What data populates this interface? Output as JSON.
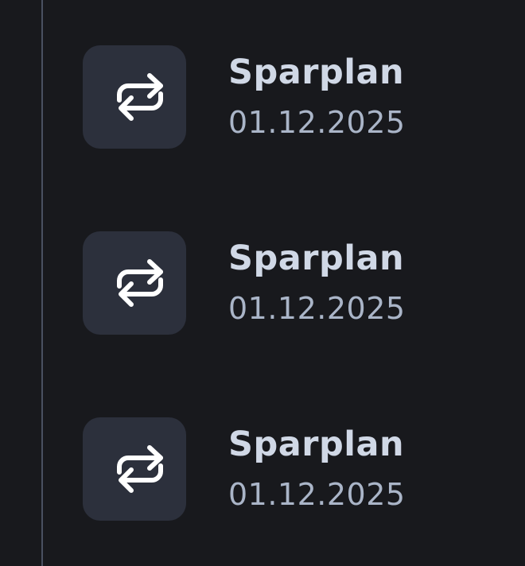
{
  "colors": {
    "background": "#18191d",
    "timeline": "#4a5161",
    "icon_tile": "#2c303c",
    "icon_stroke": "#ffffff",
    "title": "#d0d8e6",
    "date": "#aab5c8"
  },
  "transactions": [
    {
      "icon": "repeat-icon",
      "title": "Sparplan",
      "date": "01.12.2025"
    },
    {
      "icon": "repeat-icon",
      "title": "Sparplan",
      "date": "01.12.2025"
    },
    {
      "icon": "repeat-icon",
      "title": "Sparplan",
      "date": "01.12.2025"
    }
  ]
}
